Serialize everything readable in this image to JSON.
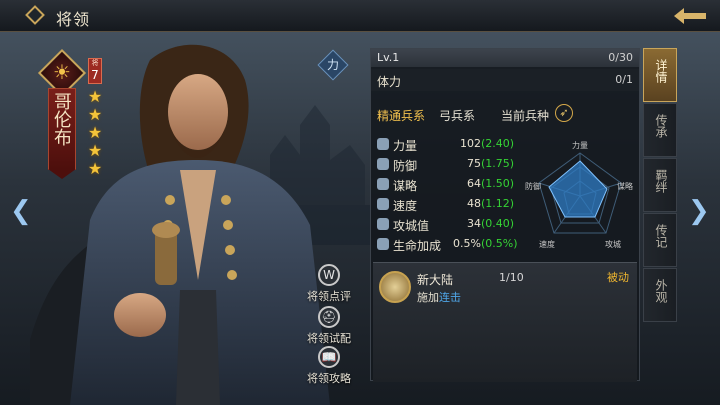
{
  "header": {
    "title": "将领"
  },
  "hero": {
    "name": "哥伦布",
    "rank_label": "将",
    "rank_level": "7",
    "stars": 5,
    "unit_type_badge": "力"
  },
  "side_actions": [
    {
      "label": "将领点评",
      "icon": "W"
    },
    {
      "label": "将领试配",
      "icon": "⛑"
    },
    {
      "label": "将领攻略",
      "icon": "📖"
    }
  ],
  "panel": {
    "level_label": "Lv.1",
    "level_value": "0/30",
    "stamina_label": "体力",
    "stamina_value": "0/1",
    "troop_title": "精通兵系",
    "troop_type": "弓兵系",
    "troop_current": "当前兵种",
    "stats": [
      {
        "name": "力量",
        "value": "102",
        "bonus": "(2.40)"
      },
      {
        "name": "防御",
        "value": "75",
        "bonus": "(1.75)"
      },
      {
        "name": "谋略",
        "value": "64",
        "bonus": "(1.50)"
      },
      {
        "name": "速度",
        "value": "48",
        "bonus": "(1.12)"
      },
      {
        "name": "攻城值",
        "value": "34",
        "bonus": "(0.40)"
      },
      {
        "name": "生命加成",
        "value": "0.5%",
        "bonus": "(0.5%)"
      }
    ],
    "radar_labels": {
      "top": "力量",
      "right_top": "谋略",
      "right_bottom": "攻城",
      "left_bottom": "速度",
      "left_top": "防御"
    },
    "skill": {
      "name": "新大陆",
      "level": "1/10",
      "type": "被动",
      "desc_prefix": "施加",
      "desc_link": "连击"
    }
  },
  "tabs": [
    "详情",
    "传承",
    "羁绊",
    "传记",
    "外观"
  ],
  "active_tab": 0
}
